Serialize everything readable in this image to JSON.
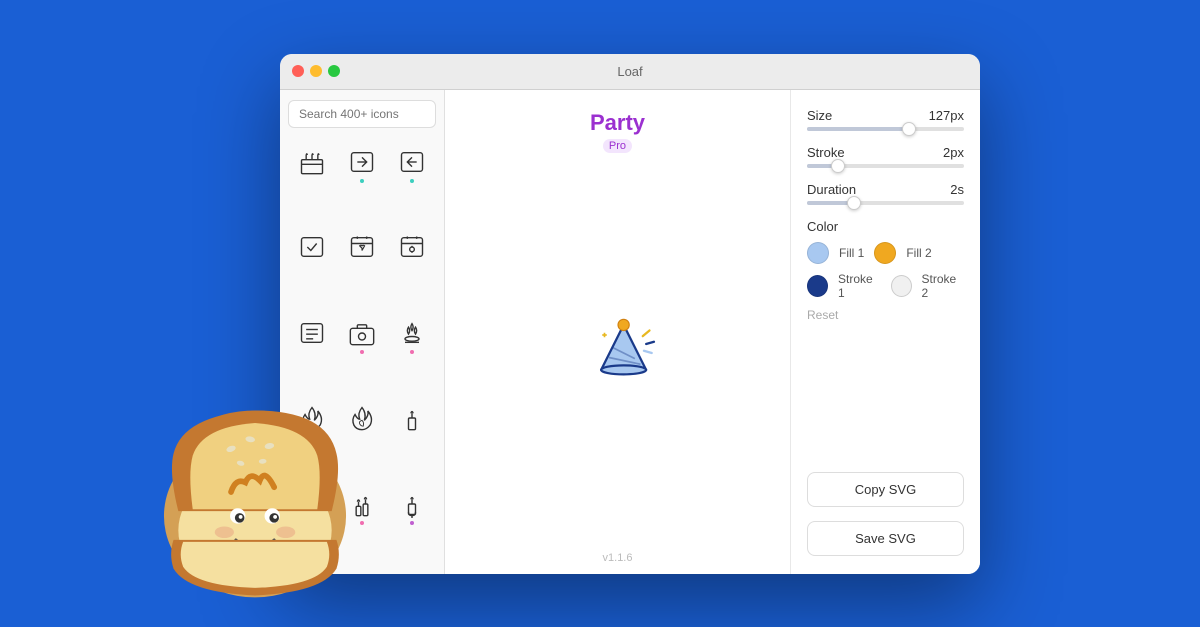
{
  "window": {
    "title": "Loaf",
    "traffic_lights": [
      "red",
      "yellow",
      "green"
    ]
  },
  "sidebar": {
    "search_placeholder": "Search 400+ icons",
    "icons": [
      {
        "id": "cake",
        "dot": "none"
      },
      {
        "id": "arrow-right",
        "dot": "teal"
      },
      {
        "id": "arrow-left",
        "dot": "teal"
      },
      {
        "id": "check-square",
        "dot": "none"
      },
      {
        "id": "heart-calendar",
        "dot": "none"
      },
      {
        "id": "settings-calendar",
        "dot": "none"
      },
      {
        "id": "list",
        "dot": "none"
      },
      {
        "id": "camera",
        "dot": "pink"
      },
      {
        "id": "campfire",
        "dot": "pink"
      },
      {
        "id": "flame1",
        "dot": "none"
      },
      {
        "id": "flame2",
        "dot": "none"
      },
      {
        "id": "candle1",
        "dot": "none"
      },
      {
        "id": "candle2",
        "dot": "none"
      },
      {
        "id": "candle3",
        "dot": "none"
      },
      {
        "id": "candle-mic",
        "dot": "purple"
      }
    ]
  },
  "center": {
    "icon_name": "Party",
    "badge": "Pro",
    "version": "v1.1.6"
  },
  "right_panel": {
    "size_label": "Size",
    "size_value": "127px",
    "size_percent": 65,
    "stroke_label": "Stroke",
    "stroke_value": "2px",
    "stroke_percent": 20,
    "duration_label": "Duration",
    "duration_value": "2s",
    "duration_percent": 30,
    "color_section_label": "Color",
    "fill1_label": "Fill 1",
    "fill1_color": "#a8c8f0",
    "fill2_label": "Fill 2",
    "fill2_color": "#f0a820",
    "stroke1_label": "Stroke 1",
    "stroke1_color": "#1a3a8a",
    "stroke2_label": "Stroke 2",
    "stroke2_color": "#f0f0f0",
    "reset_label": "Reset",
    "copy_svg_label": "Copy SVG",
    "save_svg_label": "Save SVG"
  }
}
